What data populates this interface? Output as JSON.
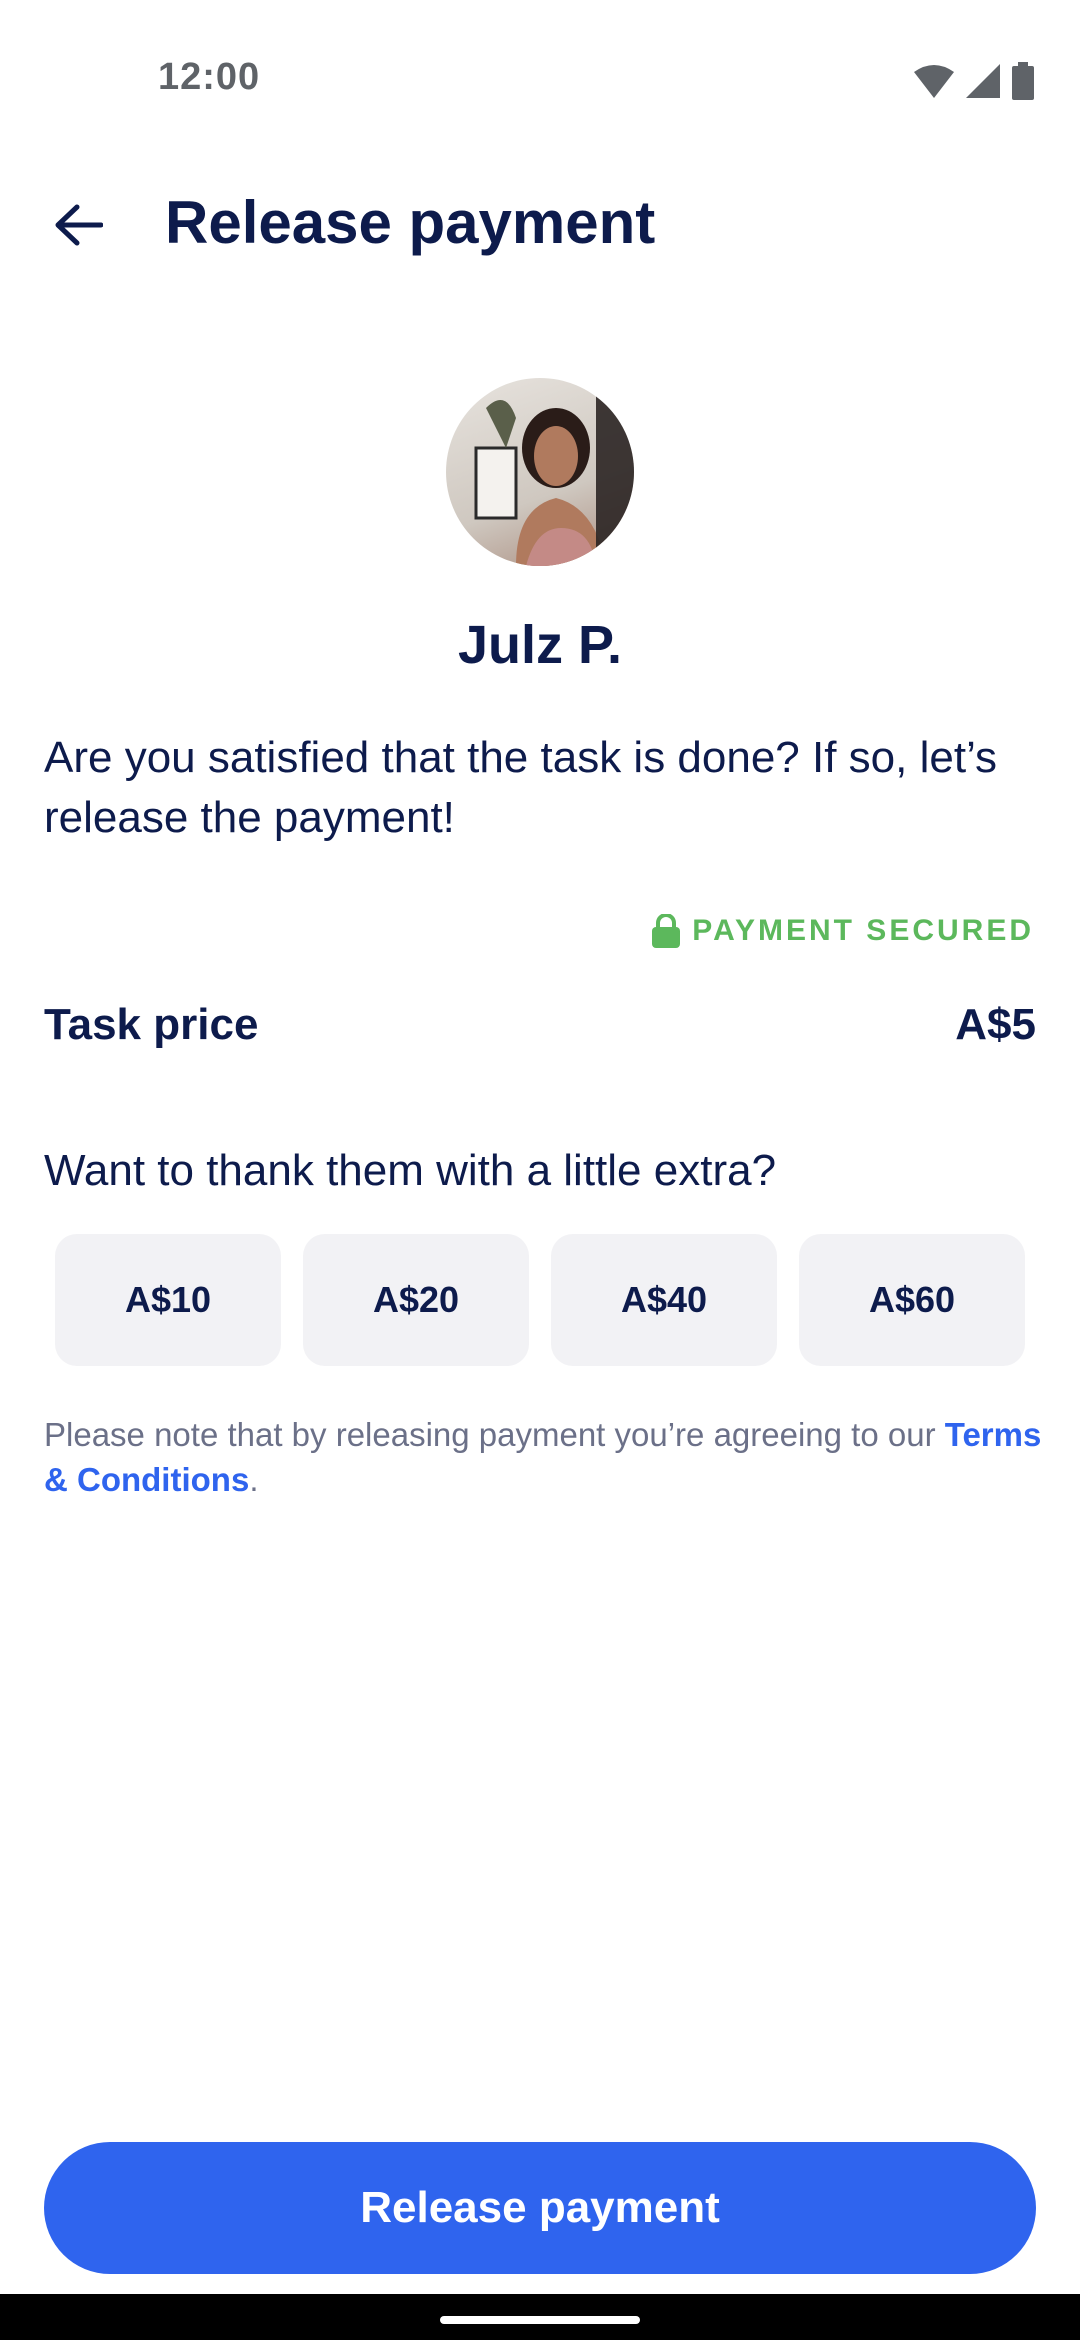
{
  "status_bar": {
    "time": "12:00"
  },
  "header": {
    "title": "Release payment",
    "back_icon": "arrow-left-icon"
  },
  "profile": {
    "name": "Julz P."
  },
  "message": "Are you satisfied that the task is done? If so, let’s release the payment!",
  "payment_status": {
    "label": "PAYMENT SECURED",
    "icon": "lock-icon",
    "color": "#5cb85c"
  },
  "task_price": {
    "label": "Task price",
    "value": "A$5"
  },
  "tip": {
    "prompt": "Want to thank them with a little extra?",
    "options": [
      "A$10",
      "A$20",
      "A$40",
      "A$60"
    ]
  },
  "note": {
    "text": "Please note that by releasing payment you’re agreeing to our ",
    "link": "Terms & Conditions",
    "suffix": "."
  },
  "primary_action": {
    "label": "Release payment",
    "color": "#2f64ee"
  }
}
